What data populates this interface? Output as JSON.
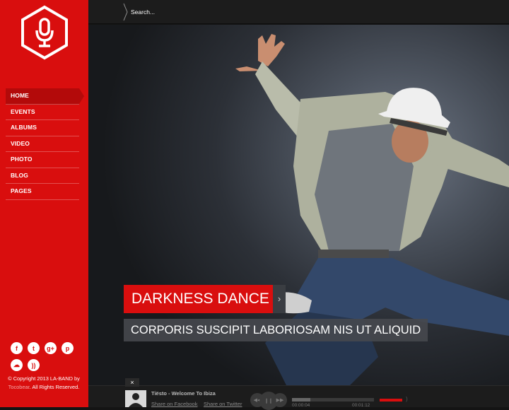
{
  "search": {
    "placeholder": "Search..."
  },
  "nav": {
    "items": [
      {
        "label": "HOME",
        "active": true
      },
      {
        "label": "EVENTS"
      },
      {
        "label": "ALBUMS"
      },
      {
        "label": "VIDEO"
      },
      {
        "label": "PHOTO"
      },
      {
        "label": "BLOG"
      },
      {
        "label": "PAGES"
      }
    ]
  },
  "social": {
    "row1": [
      "facebook-icon",
      "twitter-icon",
      "google-plus-icon",
      "pinterest-icon"
    ],
    "row2": [
      "soundcloud-icon",
      "rss-icon"
    ]
  },
  "copyright": {
    "prefix": "© Copyright 2013 LA-BAND by",
    "brand": "Tocobear",
    "suffix": ". All Rights Reserved."
  },
  "slide": {
    "title": "DARKNESS DANCE",
    "subtitle": "CORPORIS SUSCIPIT LABORIOSAM NIS UT ALIQUID"
  },
  "player": {
    "close": "×",
    "track": "Tiësto - Welcome To Ibiza",
    "share_facebook": "Share on Facebook",
    "share_twitter": "Share on Twitter",
    "time_elapsed": "00:00:04",
    "time_total": "00:01:12",
    "progress": 0.22,
    "volume": 1.0
  },
  "colors": {
    "accent": "#d90e0e",
    "background": "#141414",
    "topbar": "#1c1c1c"
  }
}
